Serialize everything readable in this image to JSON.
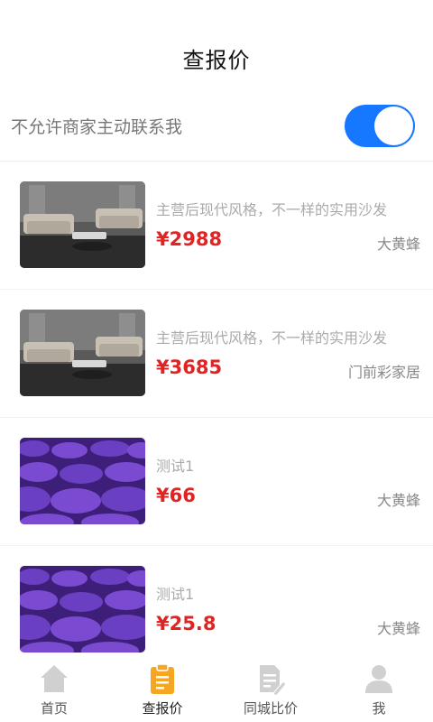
{
  "header": {
    "title": "查报价"
  },
  "contact_toggle": {
    "label": "不允许商家主动联系我",
    "enabled": true,
    "color": "#1677ff"
  },
  "items": [
    {
      "name": "主营后现代风格，不一样的实用沙发",
      "price": "¥2988",
      "shop": "大黄蜂",
      "image": "sofa"
    },
    {
      "name": "主营后现代风格，不一样的实用沙发",
      "price": "¥3685",
      "shop": "门前彩家居",
      "image": "sofa"
    },
    {
      "name": "测试1",
      "price": "¥66",
      "shop": "大黄蜂",
      "image": "lavender"
    },
    {
      "name": "测试1",
      "price": "¥25.8",
      "shop": "大黄蜂",
      "image": "lavender"
    }
  ],
  "tabbar": {
    "tabs": [
      {
        "label": "首页",
        "icon": "home-icon",
        "active": false
      },
      {
        "label": "查报价",
        "icon": "clipboard-icon",
        "active": true
      },
      {
        "label": "同城比价",
        "icon": "document-edit-icon",
        "active": false
      },
      {
        "label": "我",
        "icon": "user-icon",
        "active": false
      }
    ]
  },
  "colors": {
    "price": "#e02323",
    "accent": "#1677ff",
    "tab_active": "#f5a623",
    "tab_inactive": "#d0d0d0"
  }
}
